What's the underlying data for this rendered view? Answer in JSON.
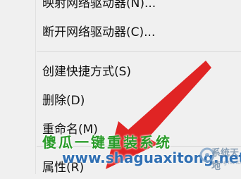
{
  "context_menu": {
    "items": [
      {
        "label": "映射网络驱动器(N)..."
      },
      {
        "label": "断开网络驱动器(C)..."
      },
      {
        "label": "创建快捷方式(S)"
      },
      {
        "label": "删除(D)"
      },
      {
        "label": "重命名(M)"
      },
      {
        "label": "属性(R)"
      }
    ]
  },
  "watermark": {
    "brand": "傻瓜一键重装系统",
    "url": "www.shaguaxitong.net",
    "logo_text": "系统天地",
    "logo_sub": "XiTongTianDi.net"
  },
  "colors": {
    "menu_background": "#f0f0f0",
    "arrow": "#e02424",
    "watermark_green": "#2a9c2a",
    "watermark_blue": "#2f6fb3"
  },
  "icons": [
    "red-arrow-pointer",
    "site-logo"
  ]
}
